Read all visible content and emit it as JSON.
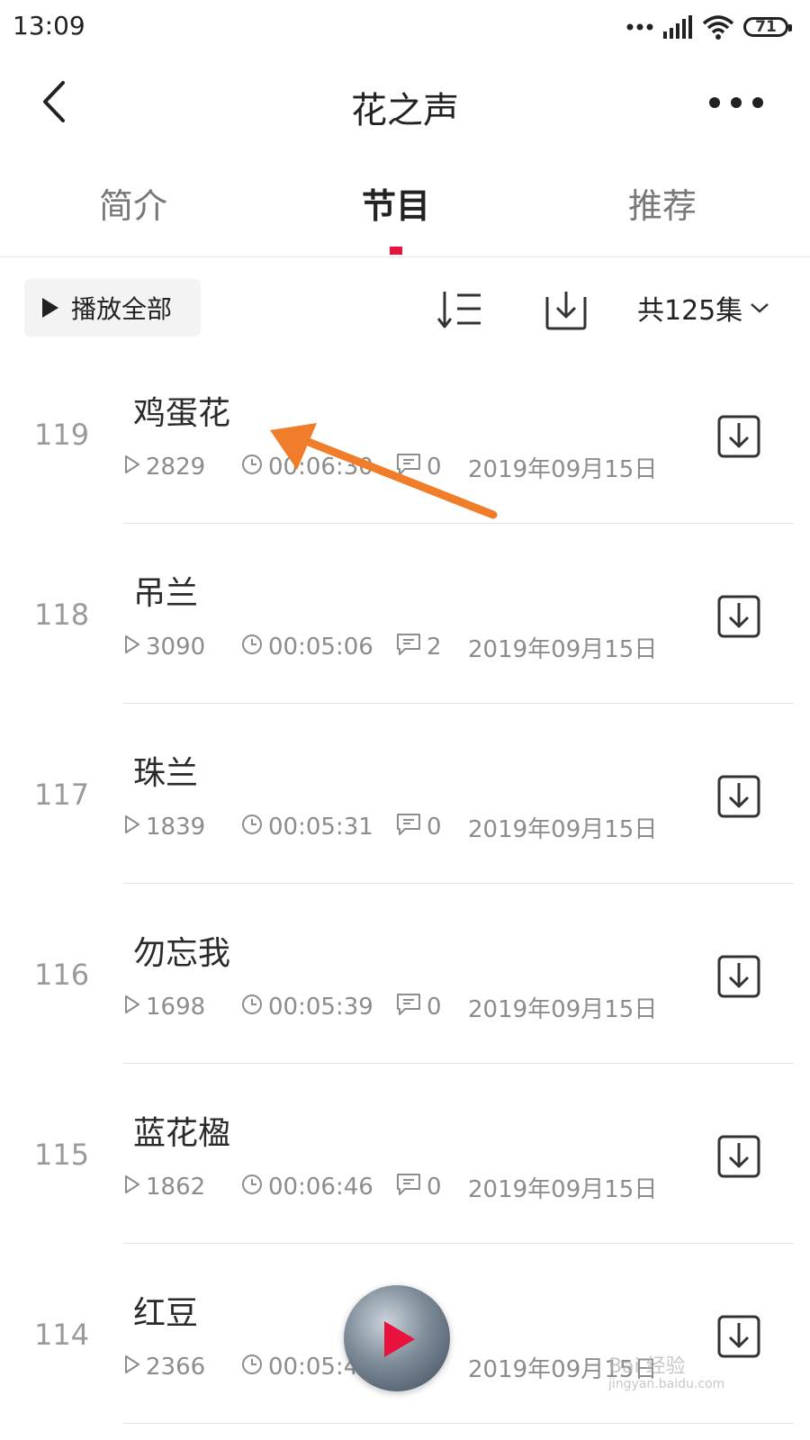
{
  "status_bar": {
    "time": "13:09",
    "battery": "71"
  },
  "header": {
    "title": "花之声"
  },
  "tabs": [
    {
      "label": "简介",
      "active": false
    },
    {
      "label": "节目",
      "active": true
    },
    {
      "label": "推荐",
      "active": false
    }
  ],
  "toolbar": {
    "play_all_label": "播放全部",
    "episode_count": "共125集"
  },
  "episodes": [
    {
      "number": "119",
      "title": "鸡蛋花",
      "plays": "2829",
      "duration": "00:06:30",
      "comments": "0",
      "date": "2019年09月15日"
    },
    {
      "number": "118",
      "title": "吊兰",
      "plays": "3090",
      "duration": "00:05:06",
      "comments": "2",
      "date": "2019年09月15日"
    },
    {
      "number": "117",
      "title": "珠兰",
      "plays": "1839",
      "duration": "00:05:31",
      "comments": "0",
      "date": "2019年09月15日"
    },
    {
      "number": "116",
      "title": "勿忘我",
      "plays": "1698",
      "duration": "00:05:39",
      "comments": "0",
      "date": "2019年09月15日"
    },
    {
      "number": "115",
      "title": "蓝花楹",
      "plays": "1862",
      "duration": "00:06:46",
      "comments": "0",
      "date": "2019年09月15日"
    },
    {
      "number": "114",
      "title": "红豆",
      "plays": "2366",
      "duration": "00:05:4",
      "comments": "",
      "date": "2019年09月15日"
    }
  ],
  "colors": {
    "accent": "#e8123c",
    "annotation_arrow": "#f07d2a"
  },
  "watermark": {
    "text": "Bai 经验",
    "sub": "jingyan.baidu.com"
  }
}
